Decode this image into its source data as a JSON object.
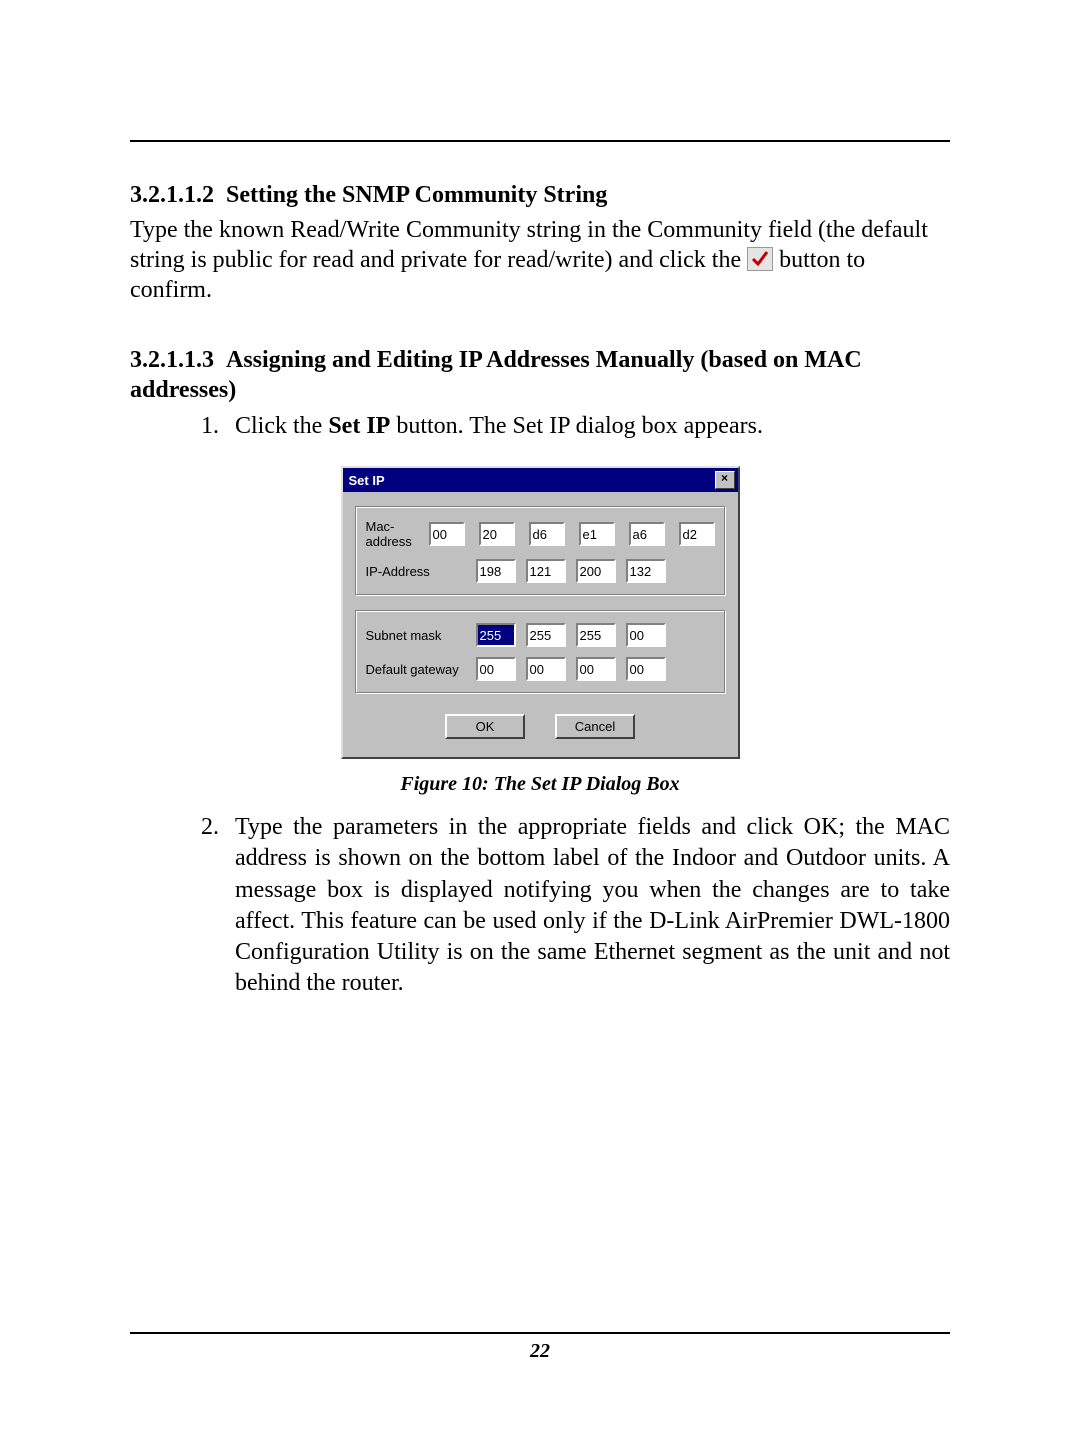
{
  "section1": {
    "number": "3.2.1.1.2",
    "title": "Setting the SNMP Community String",
    "para_before_icon": "Type the known Read/Write Community string in the Community field (the default string is public for read and private for read/write) and click the ",
    "para_after_icon": " button to confirm."
  },
  "section2": {
    "number": "3.2.1.1.3",
    "title": "Assigning and Editing IP Addresses Manually (based on MAC addresses)",
    "step1_before_bold": "Click the ",
    "step1_bold": "Set IP",
    "step1_after_bold": " button. The Set IP dialog box appears.",
    "step2": "Type the parameters in the appropriate fields and click OK; the MAC address is shown on the bottom label of the Indoor and Outdoor units. A message box is displayed notifying you when the changes are to take affect. This feature can be used only if the D-Link AirPremier DWL-1800 Configuration Utility is on the same Ethernet segment as the unit and not behind the router."
  },
  "dialog": {
    "title": "Set IP",
    "close_glyph": "×",
    "labels": {
      "mac": "Mac-address",
      "ip": "IP-Address",
      "subnet": "Subnet mask",
      "gateway": "Default gateway"
    },
    "mac": [
      "00",
      "20",
      "d6",
      "e1",
      "a6",
      "d2"
    ],
    "ip": [
      "198",
      "121",
      "200",
      "132"
    ],
    "subnet": [
      "255",
      "255",
      "255",
      "00"
    ],
    "gateway": [
      "00",
      "00",
      "00",
      "00"
    ],
    "ok": "OK",
    "cancel": "Cancel"
  },
  "figure_caption": "Figure 10: The Set IP Dialog Box",
  "page_number": "22"
}
